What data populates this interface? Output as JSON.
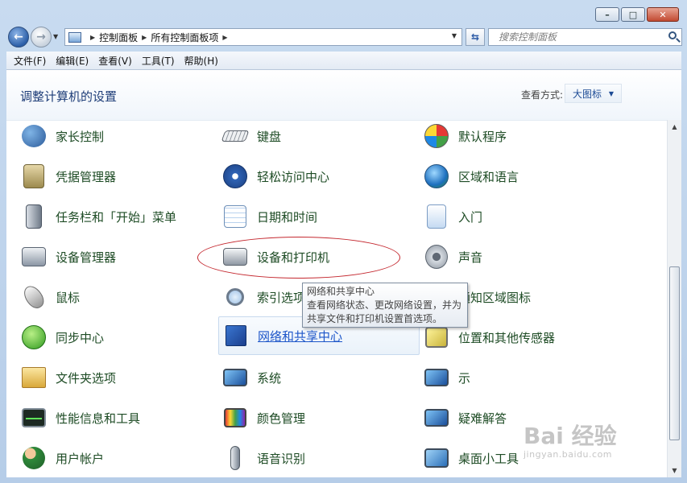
{
  "breadcrumbs": [
    "控制面板",
    "所有控制面板项"
  ],
  "search": {
    "placeholder": "搜索控制面板"
  },
  "menu": [
    "文件(F)",
    "编辑(E)",
    "查看(V)",
    "工具(T)",
    "帮助(H)"
  ],
  "page_title": "调整计算机的设置",
  "view": {
    "label": "查看方式:",
    "value": "大图标"
  },
  "items": {
    "col1": [
      "家长控制",
      "凭据管理器",
      "任务栏和「开始」菜单",
      "设备管理器",
      "鼠标",
      "同步中心",
      "文件夹选项",
      "性能信息和工具",
      "用户帐户"
    ],
    "col2": [
      "键盘",
      "轻松访问中心",
      "日期和时间",
      "设备和打印机",
      "索引选项",
      "网络和共享中心",
      "系统",
      "颜色管理",
      "语音识别"
    ],
    "col3": [
      "默认程序",
      "区域和语言",
      "入门",
      "声音",
      "通知区域图标",
      "位置和其他传感器",
      "示",
      "疑难解答",
      "桌面小工具"
    ]
  },
  "tooltip": {
    "title": "网络和共享中心",
    "line1": "查看网络状态、更改网络设置，并为",
    "line2": "共享文件和打印机设置首选项。"
  },
  "watermark": {
    "brand": "Bai 经验",
    "site": "jingyan.baidu.com"
  },
  "icons": {
    "col1": [
      "parental-controls-icon",
      "credential-manager-icon",
      "taskbar-icon",
      "device-manager-icon",
      "mouse-icon",
      "sync-center-icon",
      "folder-options-icon",
      "performance-icon",
      "user-accounts-icon"
    ],
    "col2": [
      "keyboard-icon",
      "ease-of-access-icon",
      "date-time-icon",
      "devices-printers-icon",
      "indexing-icon",
      "network-sharing-icon",
      "system-icon",
      "color-management-icon",
      "speech-recognition-icon"
    ],
    "col3": [
      "default-programs-icon",
      "region-language-icon",
      "getting-started-icon",
      "sound-icon",
      "notification-icons-icon",
      "location-sensors-icon",
      "display-icon",
      "troubleshooting-icon",
      "desktop-gadgets-icon"
    ]
  }
}
